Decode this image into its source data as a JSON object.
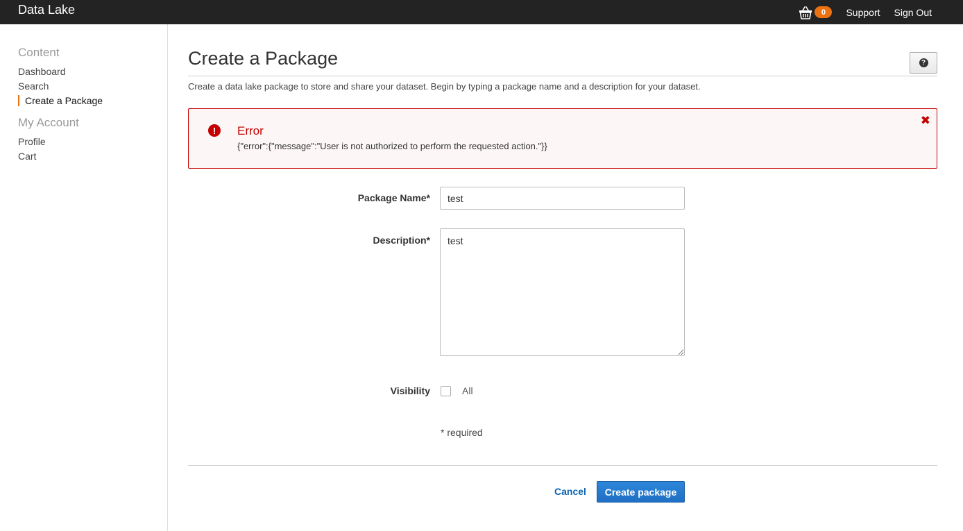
{
  "topbar": {
    "brand": "Data Lake",
    "cart_icon": "shopping-basket-icon",
    "cart_count": "0",
    "support_label": "Support",
    "signout_label": "Sign Out",
    "accent_color": "#ec7211"
  },
  "sidebar": {
    "content_heading": "Content",
    "content_items": [
      {
        "label": "Dashboard"
      },
      {
        "label": "Search"
      },
      {
        "label": "Create a Package",
        "active": true
      }
    ],
    "account_heading": "My Account",
    "account_items": [
      {
        "label": "Profile"
      },
      {
        "label": "Cart"
      }
    ]
  },
  "main": {
    "title": "Create a Package",
    "help_icon": "question-circle-icon",
    "intro": "Create a data lake package to store and share your dataset. Begin by typing a package name and a description for your dataset."
  },
  "alert": {
    "icon": "exclamation-circle-icon",
    "title": "Error",
    "message": "{\"error\":{\"message\":\"User is not authorized to perform the requested action.\"}}",
    "close_icon": "close-icon",
    "color": "#c40000"
  },
  "form": {
    "package_name_label": "Package Name*",
    "package_name_value": "test",
    "description_label": "Description*",
    "description_value": "test",
    "visibility_label": "Visibility",
    "visibility_option": "All",
    "visibility_checked": false,
    "required_note": "* required"
  },
  "actions": {
    "cancel_label": "Cancel",
    "create_label": "Create package",
    "primary_color": "#1f6fc4"
  }
}
